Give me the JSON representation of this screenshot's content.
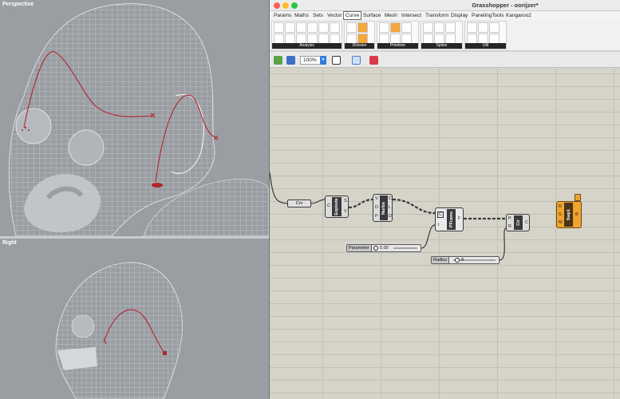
{
  "viewports": {
    "perspective_label": "Perspective",
    "right_label": "Right"
  },
  "window": {
    "title": "Grasshopper - oorijzer*"
  },
  "menu": {
    "items": [
      "Params",
      "Maths",
      "Sets",
      "Vector",
      "Curve",
      "Surface",
      "Mesh",
      "Intersect",
      "Transform",
      "Display",
      "PanelingTools",
      "Kangaroo2"
    ],
    "active": "Curve"
  },
  "ribbon": {
    "groups": [
      "Analysis",
      "Division",
      "Primitive",
      "Spline",
      "Util"
    ]
  },
  "toolbar": {
    "zoom": "100%"
  },
  "canvas": {
    "crv_label": "Crv",
    "explode": {
      "name": "Explode",
      "in": "C",
      "out": [
        "S",
        "V"
      ]
    },
    "nurbs": {
      "name": "Nurbs",
      "in": [
        "V",
        "D",
        "P"
      ],
      "out": [
        "C",
        "L",
        "D"
      ]
    },
    "pframe": {
      "name": "PFrame",
      "in": [
        "C",
        "t"
      ],
      "out": "F"
    },
    "circle": {
      "name": "Cir",
      "in": [
        "P",
        "R"
      ],
      "out": "C"
    },
    "sweep": {
      "name": "Swp1",
      "in": [
        "R",
        "S",
        "M"
      ],
      "out": "B"
    },
    "parameter_slider": {
      "label": "Parameter",
      "value": "0.00"
    },
    "radius_slider": {
      "label": "Radius",
      "value": "8"
    }
  },
  "colors": {
    "accent": "#2f7de1",
    "canvas": "#d6d3c9",
    "sweep_component": "#f0a32d",
    "curve_red": "#b3262e"
  }
}
